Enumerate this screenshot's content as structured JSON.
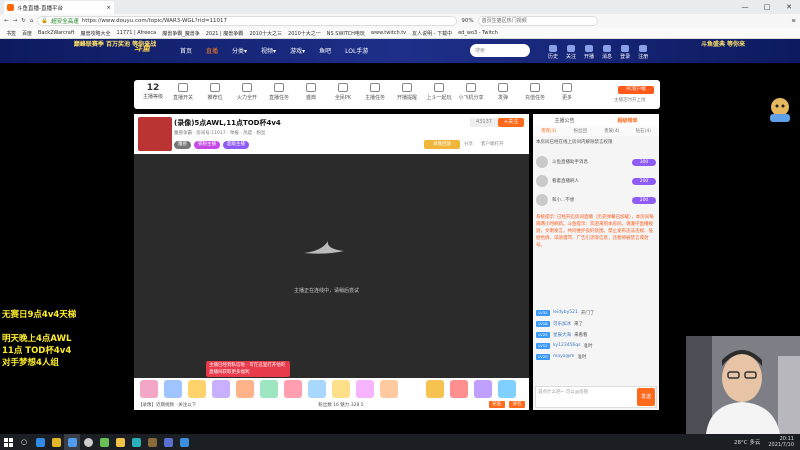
{
  "browser": {
    "tab_title": "斗鱼直播-直播平台",
    "url_secure_label": "超安全高速",
    "url": "https://www.douyu.com/topic/WAR3-WGL?rid=11017",
    "zoom": "90%",
    "search_placeholder": "首页生猫区热门视频",
    "window_buttons": [
      "—",
      "□",
      "✕"
    ],
    "bookmarks": [
      "书签",
      "百度",
      "Back2Warcraft",
      "魔兽攻略大全",
      "11771 | Afreeca",
      "魔兽争霸_魔兽争",
      "2021 | 魔兽争霸",
      "2010十大之三",
      "2010十大之一",
      "NS SWITCH电玩",
      "www.twitch.tv",
      "友人说明 - 下载中",
      "ed_wo3 - Twitch"
    ]
  },
  "site": {
    "banner_left": "巅峰联赛季 百万奖池 等你来战",
    "logo": "斗鱼",
    "nav": [
      "首页",
      "直播",
      "分类▾",
      "视频▾",
      "游戏▾",
      "鱼吧",
      "LOL手游"
    ],
    "search_placeholder": "搜索",
    "header_icons": [
      "历史",
      "关注",
      "开播",
      "消息",
      "登录",
      "注册"
    ],
    "banner_right": "斗鱼盛典 等你来"
  },
  "toolbar": {
    "level_number": "12",
    "level_label": "主播等级",
    "items": [
      "直播开关",
      "推荐位",
      "火力全开",
      "直播任务",
      "盛典",
      "全民PK",
      "主播任务",
      "开播提醒",
      "上斗一起玩",
      "小飞机分享",
      "发弹",
      "充值任务",
      "更多"
    ],
    "pc_button": "PC客户端",
    "pc_sub": "主播定时开上线"
  },
  "stream": {
    "title": "(录像)5点AWL,11点TOD杯4v4",
    "meta": "魔兽争霸 · 房间号:11017 · 举报 · 热度 · 粉丝",
    "tags": [
      "魔兽",
      "铁粉主播",
      "超级主播"
    ],
    "follow_count": "43137",
    "follow_label": "+关注",
    "promo_label": "录像回放",
    "share_label": "分享",
    "client_label": "客户端打开",
    "player_message": "主播正在连线中，请稍后尝试",
    "player_notice": "主播已经到私信啦 · 可在这里打开他的直播间获取更多福利"
  },
  "gift_bar": {
    "footer_text": "【录像】近期视频 · 关注以下",
    "stats": "粉丝数 16  魅力 328.5",
    "buttons": [
      "充值",
      "背包"
    ]
  },
  "right_panel": {
    "tabs": [
      "主播公告",
      "超级榜单"
    ],
    "sub_tabs": [
      "贵宾(1)",
      "粉丝团",
      "贵族(4)",
      "钻石(4)"
    ],
    "notice": "本房间已经在线上房间内解除禁言权限",
    "fans": [
      {
        "name": "斗鱼直播助手消息",
        "badge": "300"
      },
      {
        "name": "看着直播刷人",
        "badge": "200"
      },
      {
        "name": "和小...不想",
        "badge": "200"
      }
    ],
    "chat_system": "系统提示: 已经开启房间直播（历史弹幕已加载），本房间每隔两小时刷新。斗鱼提示：欢迎来到本房间，请遵守直播规则，文明发言，共同维护良好氛围。禁止发布违法违规、低俗色情、诽谤谩骂、广告引流等信息，违者将被禁言或封号。",
    "chat_lines": [
      {
        "level": "LV32",
        "nick": "leidyby521",
        "text": "开门了"
      },
      {
        "level": "LV18",
        "nick": "可乐加冰",
        "text": "来了"
      },
      {
        "level": "LV25",
        "nick": "星辰大海",
        "text": "来看看"
      },
      {
        "level": "LV12",
        "nick": "ky123456qs",
        "text": "准时"
      },
      {
        "level": "LV20",
        "nick": "maya@m",
        "text": "准时"
      }
    ],
    "input_placeholder": "说点什么吧~ 可以@房管",
    "send_label": "发送"
  },
  "overlay_text": {
    "line1": "无赛日9点4v4天梯",
    "line2": "明天晚上4点AWL",
    "line3": "11点 TOD杯4v4",
    "line4": "对手梦想4人组"
  },
  "taskbar": {
    "weather": "28°C 多云",
    "time": "20:11",
    "date": "2021/7/10"
  },
  "colors": {
    "accent": "#ff6a1c",
    "header_blue": "#1e2f8a",
    "overlay_yellow": "#ffef2b"
  }
}
